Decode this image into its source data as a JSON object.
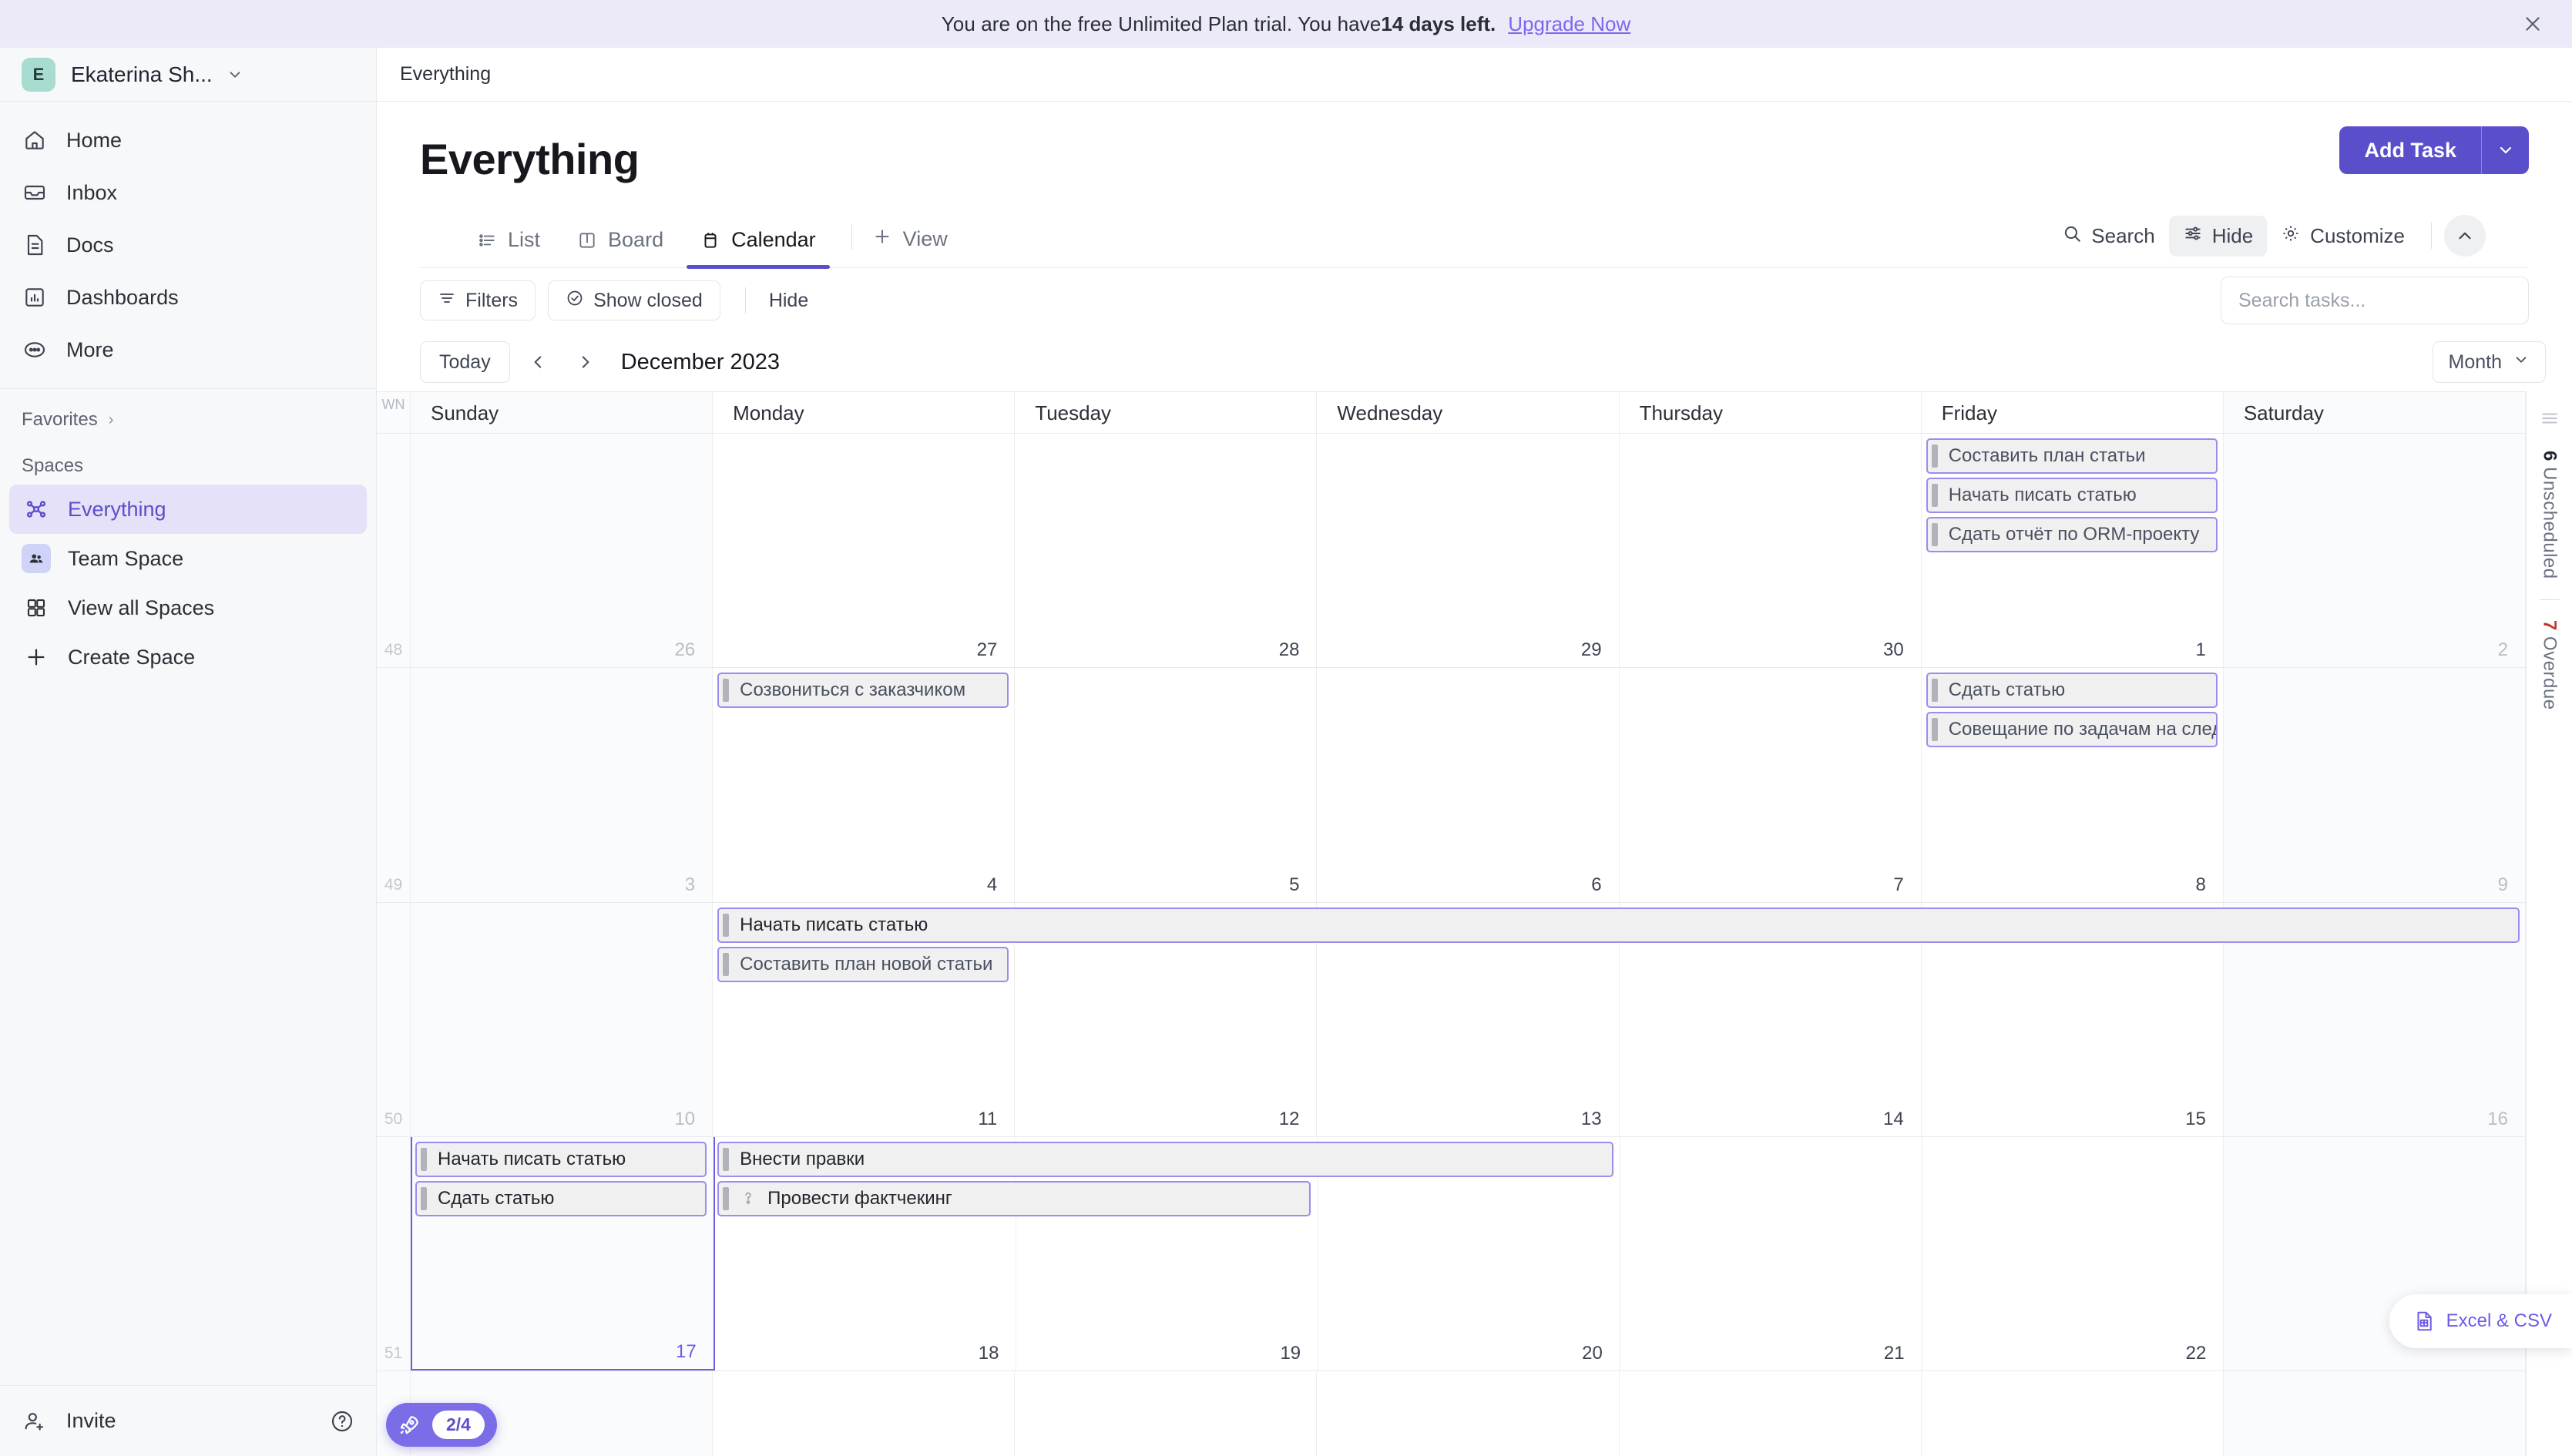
{
  "banner": {
    "text_before": "You are on the free Unlimited Plan trial. You have ",
    "days_strong": "14 days left.",
    "link": "Upgrade Now",
    "close_icon": "close-icon"
  },
  "sidebar": {
    "workspace": {
      "initial": "E",
      "name": "Ekaterina Sh...",
      "caret_icon": "chevron-down-icon"
    },
    "nav_items": [
      {
        "label": "Home",
        "icon": "home-icon"
      },
      {
        "label": "Inbox",
        "icon": "inbox-icon"
      },
      {
        "label": "Docs",
        "icon": "document-icon"
      },
      {
        "label": "Dashboards",
        "icon": "chart-icon"
      },
      {
        "label": "More",
        "icon": "ellipsis-icon"
      }
    ],
    "favorites_label": "Favorites",
    "favorites_chevron": "chevron-right-icon",
    "spaces_label": "Spaces",
    "spaces": [
      {
        "label": "Everything",
        "icon": "everything-icon",
        "active": true
      },
      {
        "label": "Team Space",
        "icon": "people-icon",
        "active": false
      },
      {
        "label": "View all Spaces",
        "icon": "grid-icon",
        "active": false
      },
      {
        "label": "Create Space",
        "icon": "plus-icon",
        "active": false
      }
    ],
    "invite_label": "Invite",
    "invite_icon": "user-plus-icon",
    "help_icon": "question-circle-icon"
  },
  "main": {
    "breadcrumb": "Everything",
    "page_title": "Everything",
    "add_task_label": "Add Task",
    "add_task_caret_icon": "chevron-down-icon",
    "tabs": [
      {
        "label": "List",
        "icon": "list-icon",
        "active": false
      },
      {
        "label": "Board",
        "icon": "board-icon",
        "active": false
      },
      {
        "label": "Calendar",
        "icon": "calendar-icon",
        "active": true
      }
    ],
    "add_view_label": "View",
    "add_view_icon": "plus-icon",
    "toolbar_right": [
      {
        "label": "Search",
        "icon": "search-icon",
        "selected": false
      },
      {
        "label": "Hide",
        "icon": "sliders-icon",
        "selected": true
      },
      {
        "label": "Customize",
        "icon": "gear-icon",
        "selected": false
      }
    ],
    "collapse_icon": "chevron-up-icon",
    "filters": {
      "filters_label": "Filters",
      "filters_icon": "filter-icon",
      "show_closed_label": "Show closed",
      "show_closed_icon": "check-circle-icon",
      "hide_label": "Hide",
      "search_placeholder": "Search tasks...",
      "search_value": ""
    }
  },
  "calendar": {
    "today_label": "Today",
    "prev_icon": "chevron-left-icon",
    "next_icon": "chevron-right-icon",
    "month_title": "December 2023",
    "view_mode": "Month",
    "view_mode_icon": "chevron-down-icon",
    "wn_header": "WN",
    "day_names": [
      "Sunday",
      "Monday",
      "Tuesday",
      "Wednesday",
      "Thursday",
      "Friday",
      "Saturday"
    ],
    "weeks": [
      {
        "week_number": "48",
        "days": [
          {
            "num": "26",
            "muted": true,
            "weekend": true,
            "today": false
          },
          {
            "num": "27",
            "muted": false,
            "weekend": false,
            "today": false
          },
          {
            "num": "28",
            "muted": false,
            "weekend": false,
            "today": false
          },
          {
            "num": "29",
            "muted": false,
            "weekend": false,
            "today": false
          },
          {
            "num": "30",
            "muted": false,
            "weekend": false,
            "today": false
          },
          {
            "num": "1",
            "muted": false,
            "weekend": false,
            "today": false
          },
          {
            "num": "2",
            "muted": true,
            "weekend": true,
            "today": false
          }
        ],
        "tasks": [
          {
            "title": "Составить план статьи",
            "start": 5,
            "span": 1,
            "row": 0,
            "dark": false,
            "subtask_icon": null
          },
          {
            "title": "Начать писать статью",
            "start": 5,
            "span": 1,
            "row": 1,
            "dark": false,
            "subtask_icon": null
          },
          {
            "title": "Сдать отчёт по ORM-проекту",
            "start": 5,
            "span": 1,
            "row": 2,
            "dark": false,
            "subtask_icon": null
          }
        ]
      },
      {
        "week_number": "49",
        "days": [
          {
            "num": "3",
            "muted": true,
            "weekend": true,
            "today": false
          },
          {
            "num": "4",
            "muted": false,
            "weekend": false,
            "today": false
          },
          {
            "num": "5",
            "muted": false,
            "weekend": false,
            "today": false
          },
          {
            "num": "6",
            "muted": false,
            "weekend": false,
            "today": false
          },
          {
            "num": "7",
            "muted": false,
            "weekend": false,
            "today": false
          },
          {
            "num": "8",
            "muted": false,
            "weekend": false,
            "today": false
          },
          {
            "num": "9",
            "muted": true,
            "weekend": true,
            "today": false
          }
        ],
        "tasks": [
          {
            "title": "Созвониться с заказчиком",
            "start": 1,
            "span": 1,
            "row": 0,
            "dark": false,
            "subtask_icon": null
          },
          {
            "title": "Сдать статью",
            "start": 5,
            "span": 1,
            "row": 0,
            "dark": false,
            "subtask_icon": null
          },
          {
            "title": "Совещание по задачам на следующую неделю",
            "start": 5,
            "span": 1,
            "row": 1,
            "dark": false,
            "subtask_icon": null
          }
        ]
      },
      {
        "week_number": "50",
        "days": [
          {
            "num": "10",
            "muted": true,
            "weekend": true,
            "today": false
          },
          {
            "num": "11",
            "muted": false,
            "weekend": false,
            "today": false
          },
          {
            "num": "12",
            "muted": false,
            "weekend": false,
            "today": false
          },
          {
            "num": "13",
            "muted": false,
            "weekend": false,
            "today": false
          },
          {
            "num": "14",
            "muted": false,
            "weekend": false,
            "today": false
          },
          {
            "num": "15",
            "muted": false,
            "weekend": false,
            "today": false
          },
          {
            "num": "16",
            "muted": true,
            "weekend": true,
            "today": false
          }
        ],
        "tasks": [
          {
            "title": "Начать писать статью",
            "start": 1,
            "span": 6,
            "row": 0,
            "dark": true,
            "subtask_icon": null
          },
          {
            "title": "Составить план новой статьи",
            "start": 1,
            "span": 1,
            "row": 1,
            "dark": false,
            "subtask_icon": null
          }
        ]
      },
      {
        "week_number": "51",
        "days": [
          {
            "num": "17",
            "muted": false,
            "weekend": true,
            "today": true
          },
          {
            "num": "18",
            "muted": false,
            "weekend": false,
            "today": false
          },
          {
            "num": "19",
            "muted": false,
            "weekend": false,
            "today": false
          },
          {
            "num": "20",
            "muted": false,
            "weekend": false,
            "today": false
          },
          {
            "num": "21",
            "muted": false,
            "weekend": false,
            "today": false
          },
          {
            "num": "22",
            "muted": false,
            "weekend": false,
            "today": false
          },
          {
            "num": "",
            "muted": false,
            "weekend": true,
            "today": false
          }
        ],
        "tasks": [
          {
            "title": "Начать писать статью",
            "start": 0,
            "span": 1,
            "row": 0,
            "dark": true,
            "subtask_icon": null
          },
          {
            "title": "Сдать статью",
            "start": 0,
            "span": 1,
            "row": 1,
            "dark": true,
            "subtask_icon": null
          },
          {
            "title": "Внести правки",
            "start": 1,
            "span": 3,
            "row": 0,
            "dark": true,
            "subtask_icon": null
          },
          {
            "title": "Провести фактчекинг",
            "start": 1,
            "span": 2,
            "row": 1,
            "dark": true,
            "subtask_icon": "subtask-link-icon"
          }
        ]
      },
      {
        "week_number": "",
        "days": [
          {
            "num": "",
            "muted": false,
            "weekend": true,
            "today": false
          },
          {
            "num": "",
            "muted": false,
            "weekend": false,
            "today": false
          },
          {
            "num": "",
            "muted": false,
            "weekend": false,
            "today": false
          },
          {
            "num": "",
            "muted": false,
            "weekend": false,
            "today": false
          },
          {
            "num": "",
            "muted": false,
            "weekend": false,
            "today": false
          },
          {
            "num": "",
            "muted": false,
            "weekend": false,
            "today": false
          },
          {
            "num": "",
            "muted": false,
            "weekend": true,
            "today": false
          }
        ],
        "tasks": []
      }
    ]
  },
  "right_rail": {
    "handle_icon": "drag-handle-icon",
    "unscheduled_count": "6",
    "unscheduled_label": "Unscheduled",
    "overdue_count": "7",
    "overdue_label": "Overdue"
  },
  "widgets": {
    "rocket_icon": "rocket-icon",
    "rocket_count": "2/4",
    "excel_icon": "spreadsheet-icon",
    "excel_label": "Excel & CSV"
  },
  "colors": {
    "accent": "#5b4ecb",
    "task_border": "#9b8cf0",
    "overdue": "#c0392b",
    "banner_bg": "#eceaf8"
  }
}
